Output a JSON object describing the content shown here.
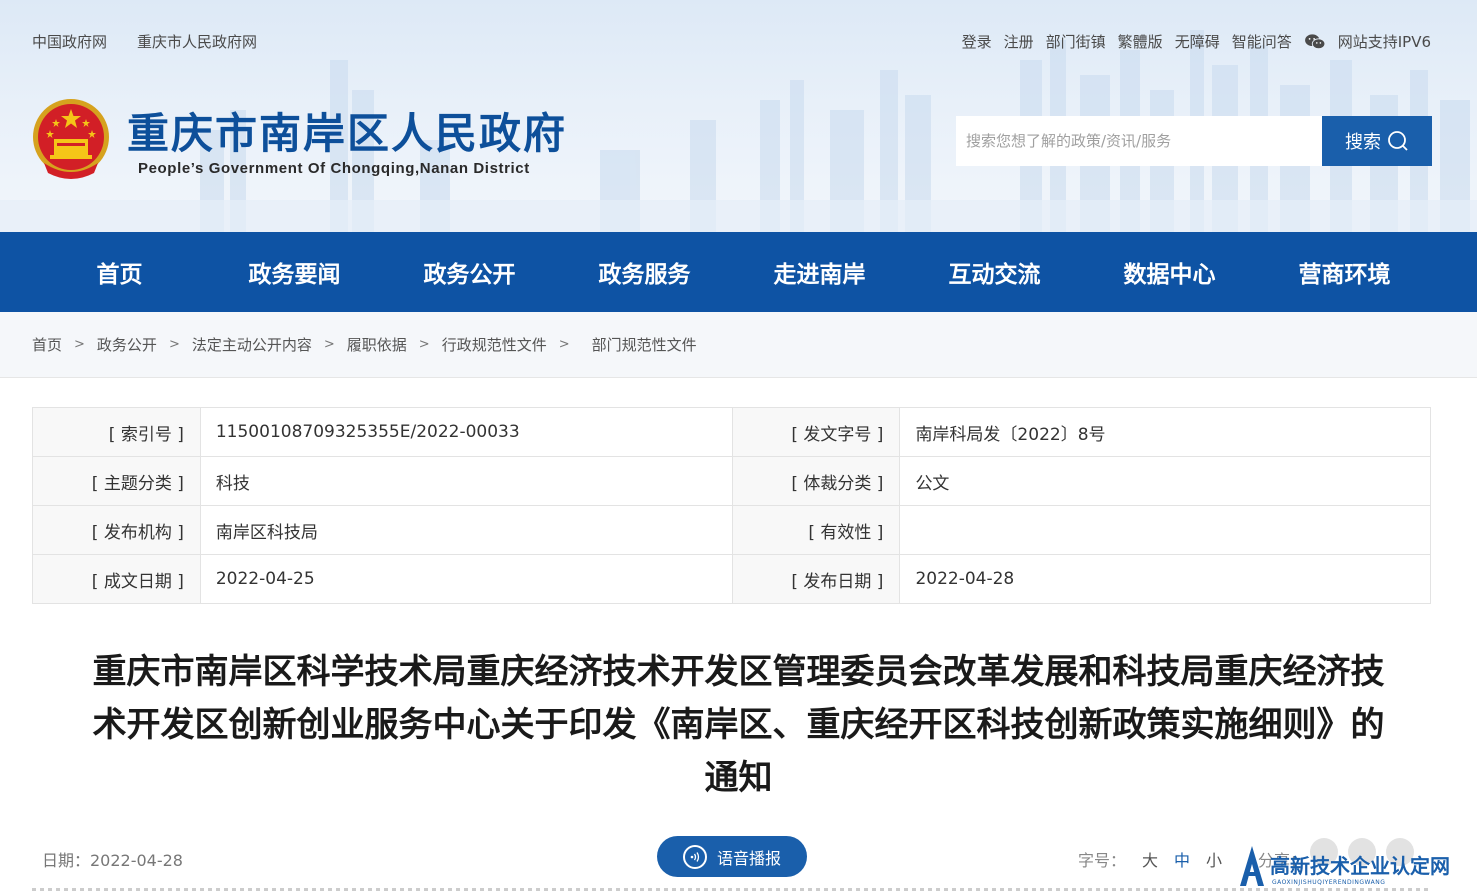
{
  "header": {
    "top_links_left": [
      "中国政府网",
      "重庆市人民政府网"
    ],
    "top_links_right": [
      "登录",
      "注册",
      "部门街镇",
      "繁體版",
      "无障碍",
      "智能问答"
    ],
    "ipv6_text": "网站支持IPV6",
    "site_title": "重庆市南岸区人民政府",
    "site_subtitle": "People’s Government Of Chongqing,Nanan District",
    "search_placeholder": "搜索您想了解的政策/资讯/服务",
    "search_button": "搜索"
  },
  "nav": {
    "items": [
      "首页",
      "政务要闻",
      "政务公开",
      "政务服务",
      "走进南岸",
      "互动交流",
      "数据中心",
      "营商环境"
    ]
  },
  "breadcrumb": {
    "items": [
      "首页",
      "政务公开",
      "法定主动公开内容",
      "履职依据",
      "行政规范性文件",
      "部门规范性文件"
    ],
    "separator": ">"
  },
  "info": {
    "rows": [
      {
        "l1": "[ 索引号 ]",
        "v1": "11500108709325355E/2022-00033",
        "l2": "[ 发文字号 ]",
        "v2": "南岸科局发〔2022〕8号"
      },
      {
        "l1": "[ 主题分类 ]",
        "v1": "科技",
        "l2": "[ 体裁分类 ]",
        "v2": "公文"
      },
      {
        "l1": "[ 发布机构 ]",
        "v1": "南岸区科技局",
        "l2": "[ 有效性 ]",
        "v2": ""
      },
      {
        "l1": "[ 成文日期 ]",
        "v1": "2022-04-25",
        "l2": "[ 发布日期 ]",
        "v2": "2022-04-28"
      }
    ]
  },
  "article": {
    "title_line1": "重庆市南岸区科学技术局重庆经济技术开发区管理委员会改革发展和科技局重庆经济技",
    "title_line2": "术开发区创新创业服务中心关于印发《南岸区、重庆经开区科技创新政策实施细则》的",
    "title_line3": "通知",
    "date_label": "日期：2022-04-28",
    "voice_button": "语音播报",
    "font_size_label": "字号：",
    "font_sizes": [
      "大",
      "中",
      "小"
    ],
    "share_label": "分享："
  },
  "watermark": {
    "text": "高新技术企业认定网",
    "sub": "GAOXINJISHUQIYERENDINGWANG"
  },
  "colors": {
    "primary": "#0e53a4",
    "title": "#0d4f9a"
  }
}
